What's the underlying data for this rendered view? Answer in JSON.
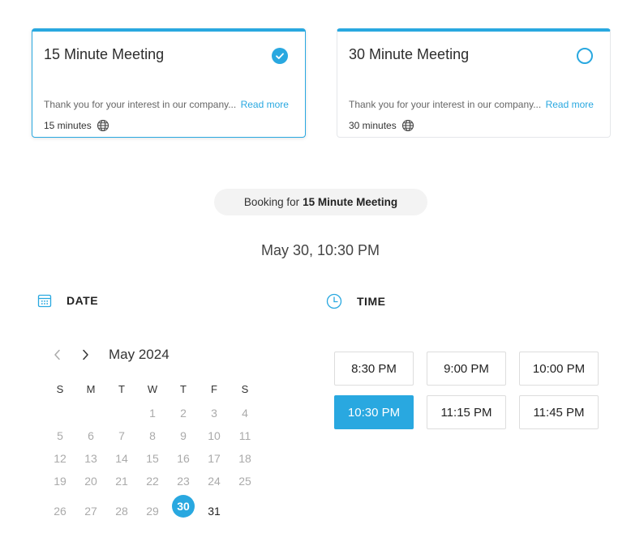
{
  "colors": {
    "accent": "#29a8e0",
    "pill_bg": "#f3f3f3"
  },
  "meetings": [
    {
      "title": "15 Minute Meeting",
      "description": "Thank you for your interest in our company...",
      "read_more": "Read more",
      "duration": "15 minutes",
      "selected": true,
      "icons": [
        "check-icon",
        "globe-icon"
      ]
    },
    {
      "title": "30 Minute Meeting",
      "description": "Thank you for your interest in our company...",
      "read_more": "Read more",
      "duration": "30 minutes",
      "selected": false,
      "icons": [
        "radio-empty-icon",
        "globe-icon"
      ]
    }
  ],
  "booking": {
    "prefix": "Booking for",
    "meeting": "15 Minute Meeting"
  },
  "selected_datetime": "May 30, 10:30 PM",
  "date_section": {
    "label": "DATE",
    "icon": "calendar-icon"
  },
  "time_section": {
    "label": "TIME",
    "icon": "clock-icon"
  },
  "calendar": {
    "month_label": "May 2024",
    "weekdays": [
      "S",
      "M",
      "T",
      "W",
      "T",
      "F",
      "S"
    ],
    "leading_blanks": 3,
    "days": [
      "1",
      "2",
      "3",
      "4",
      "5",
      "6",
      "7",
      "8",
      "9",
      "10",
      "11",
      "12",
      "13",
      "14",
      "15",
      "16",
      "17",
      "18",
      "19",
      "20",
      "21",
      "22",
      "23",
      "24",
      "25",
      "26",
      "27",
      "28",
      "29",
      "30",
      "31"
    ],
    "selected_day": "30",
    "available_days": [
      "30",
      "31"
    ]
  },
  "time_slots": [
    {
      "label": "8:30 PM",
      "selected": false
    },
    {
      "label": "9:00 PM",
      "selected": false
    },
    {
      "label": "10:00 PM",
      "selected": false
    },
    {
      "label": "10:30 PM",
      "selected": true
    },
    {
      "label": "11:15 PM",
      "selected": false
    },
    {
      "label": "11:45 PM",
      "selected": false
    }
  ]
}
